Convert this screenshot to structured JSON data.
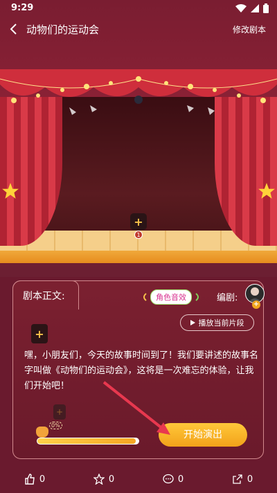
{
  "status": {
    "time": "9:29"
  },
  "header": {
    "title": "动物们的运动会",
    "edit_label": "修改剧本"
  },
  "stage": {
    "role_slot_icon": "+",
    "role_badge": "1"
  },
  "card": {
    "tab_label": "剧本正文:",
    "sfx_label": "角色音效",
    "author_label": "编剧:",
    "play_segment_label": "播放当前片段",
    "story_text": "嘿，小朋友们，今天的故事时间到了！我们要讲述的故事名字叫做《动物们的运动会》，这将是一次难忘的体验，让我们开始吧！",
    "progress_percent_label": "0%",
    "progress": 0.0,
    "start_label": "开始演出"
  },
  "bottombar": {
    "like_count": "0",
    "favorite_count": "0",
    "comment_count": "0",
    "share_count": "0"
  },
  "colors": {
    "accent": "#f2a21a",
    "background": "#6a1a2e"
  }
}
